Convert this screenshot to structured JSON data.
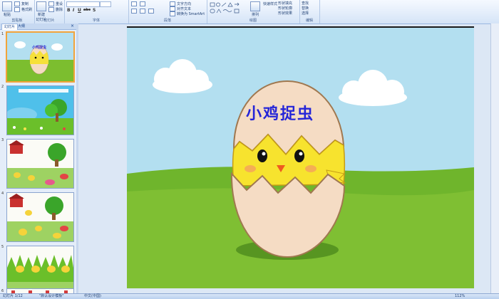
{
  "ribbon": {
    "clipboard": {
      "group": "剪贴板",
      "paste": "粘贴",
      "copy": "复制",
      "format_painter": "格式刷"
    },
    "slides": {
      "group": "幻灯片",
      "new_slide": "新建\n幻灯片",
      "reset": "重设",
      "delete": "删除"
    },
    "font": {
      "group": "字体",
      "font_name": "",
      "bold": "B",
      "italic": "I",
      "underline": "U",
      "strike": "abc",
      "shadow": "S"
    },
    "paragraph": {
      "group": "段落",
      "text_direction": "文字方向",
      "align_text": "对齐文本",
      "smartart": "转换为 SmartArt"
    },
    "drawing": {
      "group": "绘图",
      "arrange": "排列",
      "quick_styles": "快速样式",
      "shape_fill": "形状填充",
      "shape_outline": "形状轮廓",
      "shape_effects": "形状效果"
    },
    "editing": {
      "group": "编辑",
      "find": "查找",
      "replace": "替换",
      "select": "选择"
    }
  },
  "panel": {
    "tab_slides": "幻灯片",
    "tab_outline": "大纲",
    "close": "×",
    "thumb_numbers": [
      "1",
      "2",
      "3",
      "4",
      "5",
      "6"
    ]
  },
  "slide": {
    "title": "小鸡捉虫"
  },
  "status": {
    "slide_info": "幻灯片 1/12",
    "theme": "\"默认设计模板\"",
    "language": "中文(中国)",
    "zoom": "112%"
  }
}
